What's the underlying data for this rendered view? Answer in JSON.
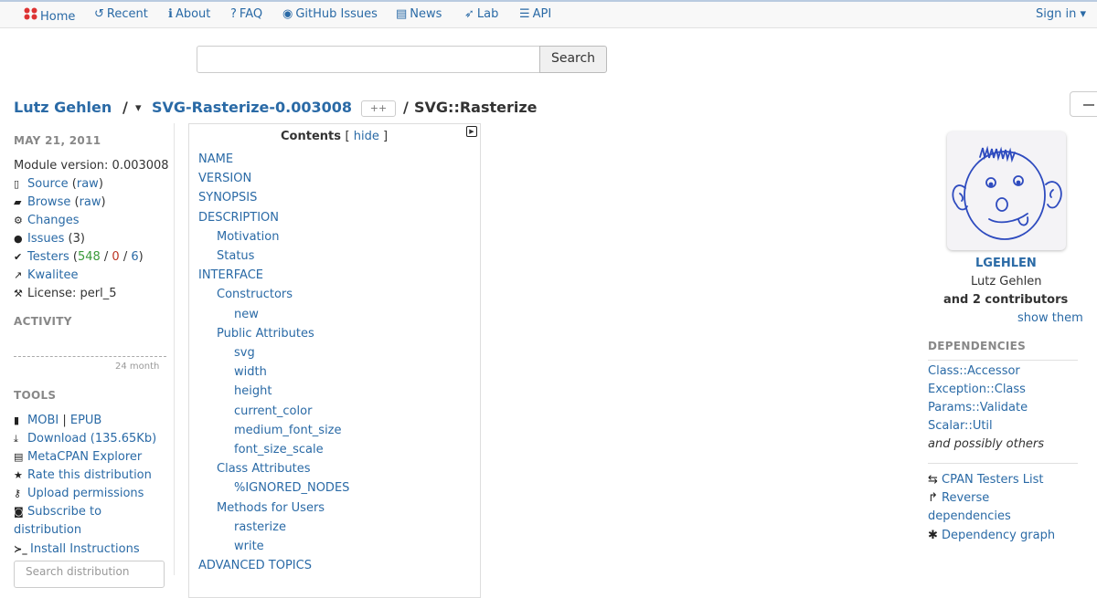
{
  "nav": {
    "items": [
      {
        "icon": "home-icon",
        "glyph": "⬢",
        "label": "Home"
      },
      {
        "icon": "history-icon",
        "glyph": "↺",
        "label": "Recent"
      },
      {
        "icon": "info-icon",
        "glyph": "ℹ",
        "label": "About"
      },
      {
        "icon": "question-icon",
        "glyph": "?",
        "label": "FAQ"
      },
      {
        "icon": "github-icon",
        "glyph": "◉",
        "label": "GitHub Issues"
      },
      {
        "icon": "newspaper-icon",
        "glyph": "▤",
        "label": "News"
      },
      {
        "icon": "rocket-icon",
        "glyph": "➶",
        "label": "Lab"
      },
      {
        "icon": "database-icon",
        "glyph": "☰",
        "label": "API"
      }
    ],
    "signin": "Sign in ▾"
  },
  "search": {
    "placeholder": "",
    "button": "Search"
  },
  "breadcrumb": {
    "author": "Lutz Gehlen",
    "sep1": "/",
    "dropdown": "▾",
    "release": "SVG-Rasterize-0.003008",
    "plusplus": "++",
    "sep2": "/",
    "module": "SVG::Rasterize"
  },
  "left": {
    "date": "MAY 21, 2011",
    "version_label": "Module version:",
    "version": "0.003008",
    "source": "Source",
    "source_raw": "raw",
    "browse": "Browse",
    "browse_raw": "raw",
    "changes": "Changes",
    "issues": "Issues",
    "issues_count": "(3)",
    "testers": "Testers",
    "testers_pass": "548",
    "testers_fail": "0",
    "testers_na": "6",
    "kwalitee": "Kwalitee",
    "license": "License: perl_5",
    "activity_header": "ACTIVITY",
    "activity_period": "24 month",
    "tools_header": "TOOLS",
    "mobi": "MOBI",
    "epub": "EPUB",
    "download": "Download (135.65Kb)",
    "explorer": "MetaCPAN Explorer",
    "rate": "Rate this distribution",
    "upload": "Upload permissions",
    "subscribe1": "Subscribe to",
    "subscribe2": "distribution",
    "install": "Install Instructions",
    "search_dist_placeholder": "Search distribution"
  },
  "toc": {
    "title": "Contents",
    "hide": "hide",
    "items": [
      {
        "label": "NAME",
        "level": 0
      },
      {
        "label": "VERSION",
        "level": 0
      },
      {
        "label": "SYNOPSIS",
        "level": 0
      },
      {
        "label": "DESCRIPTION",
        "level": 0
      },
      {
        "label": "Motivation",
        "level": 1
      },
      {
        "label": "Status",
        "level": 1
      },
      {
        "label": "INTERFACE",
        "level": 0
      },
      {
        "label": "Constructors",
        "level": 1
      },
      {
        "label": "new",
        "level": 2
      },
      {
        "label": "Public Attributes",
        "level": 1
      },
      {
        "label": "svg",
        "level": 2
      },
      {
        "label": "width",
        "level": 2
      },
      {
        "label": "height",
        "level": 2
      },
      {
        "label": "current_color",
        "level": 2
      },
      {
        "label": "medium_font_size",
        "level": 2
      },
      {
        "label": "font_size_scale",
        "level": 2
      },
      {
        "label": "Class Attributes",
        "level": 1
      },
      {
        "label": "%IGNORED_NODES",
        "level": 2
      },
      {
        "label": "Methods for Users",
        "level": 1
      },
      {
        "label": "rasterize",
        "level": 2
      },
      {
        "label": "write",
        "level": 2
      },
      {
        "label": "ADVANCED TOPICS",
        "level": 0
      }
    ]
  },
  "right": {
    "author_id": "LGEHLEN",
    "author_name": "Lutz Gehlen",
    "contributors": "and 2 contributors",
    "show_them": "show them",
    "dependencies_header": "DEPENDENCIES",
    "dependencies": [
      "Class::Accessor",
      "Exception::Class",
      "Params::Validate",
      "Scalar::Util"
    ],
    "possibly_others": "and possibly others",
    "cpan_testers": "CPAN Testers List",
    "reverse1": "Reverse",
    "reverse2": "dependencies",
    "dep_graph": "Dependency graph"
  },
  "colors": {
    "link": "#2a6aa6",
    "pass": "#3a9a3a",
    "fail": "#b32"
  }
}
